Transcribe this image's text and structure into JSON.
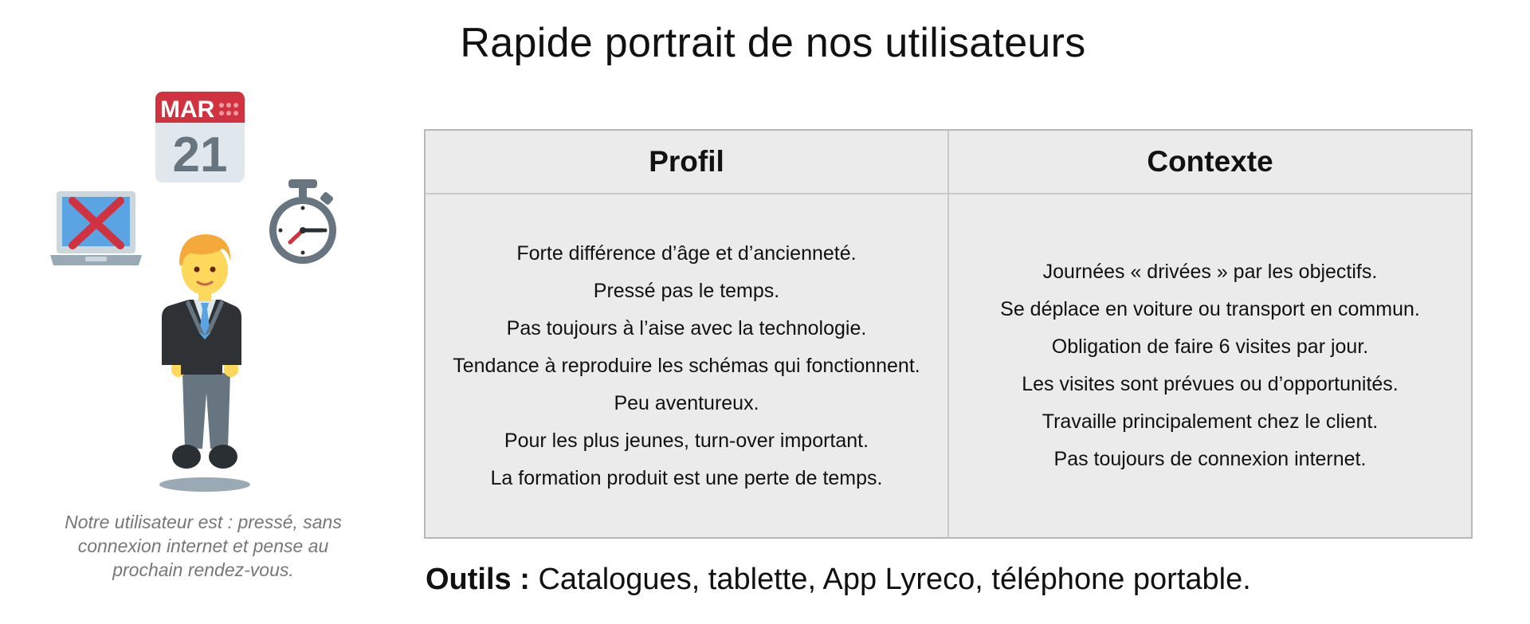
{
  "title": "Rapide portrait de nos utilisateurs",
  "illustration": {
    "calendar_month": "MAR",
    "calendar_day": "21",
    "caption": "Notre utilisateur est : pressé, sans connexion internet et pense au prochain rendez-vous.",
    "colors": {
      "calendar_red": "#d0323f",
      "suit": "#2e3235",
      "hair": "#f5a93a",
      "skin": "#fdd85a",
      "tie": "#5aa4e3"
    }
  },
  "table": {
    "profil": {
      "header": "Profil",
      "lines": [
        "Forte différence d’âge et d’ancienneté.",
        "Pressé pas le temps.",
        "Pas toujours à l’aise avec la technologie.",
        "Tendance à reproduire les schémas qui fonctionnent.",
        "Peu aventureux.",
        "Pour les plus jeunes, turn-over important.",
        "La formation produit est une perte de temps."
      ]
    },
    "contexte": {
      "header": "Contexte",
      "lines": [
        "Journées « drivées » par les objectifs.",
        "Se déplace en voiture ou transport en commun.",
        "Obligation de faire 6 visites par jour.",
        "Les visites sont prévues ou d’opportunités.",
        "Travaille principalement chez le client.",
        "Pas toujours de connexion internet."
      ]
    }
  },
  "tools": {
    "label": "Outils :",
    "value": " Catalogues, tablette, App Lyreco, téléphone portable."
  }
}
